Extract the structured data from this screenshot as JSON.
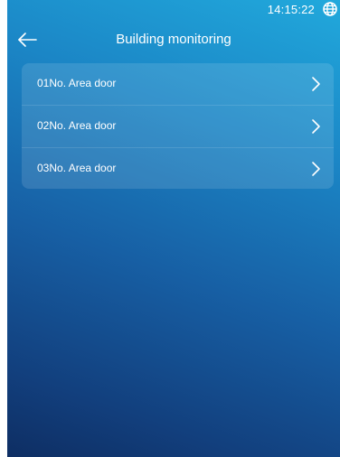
{
  "status_bar": {
    "time": "14:15:22",
    "globe_icon": "globe-icon"
  },
  "header": {
    "back_icon": "arrow-left-icon",
    "title": "Building monitoring"
  },
  "doors": [
    {
      "label": "01No. Area door",
      "icon": "chevron-right-icon"
    },
    {
      "label": "02No. Area door",
      "icon": "chevron-right-icon"
    },
    {
      "label": "03No. Area door",
      "icon": "chevron-right-icon"
    }
  ],
  "colors": {
    "gradient_top": "#21a9dc",
    "gradient_bottom": "#0e2e63",
    "text": "#ffffff"
  }
}
